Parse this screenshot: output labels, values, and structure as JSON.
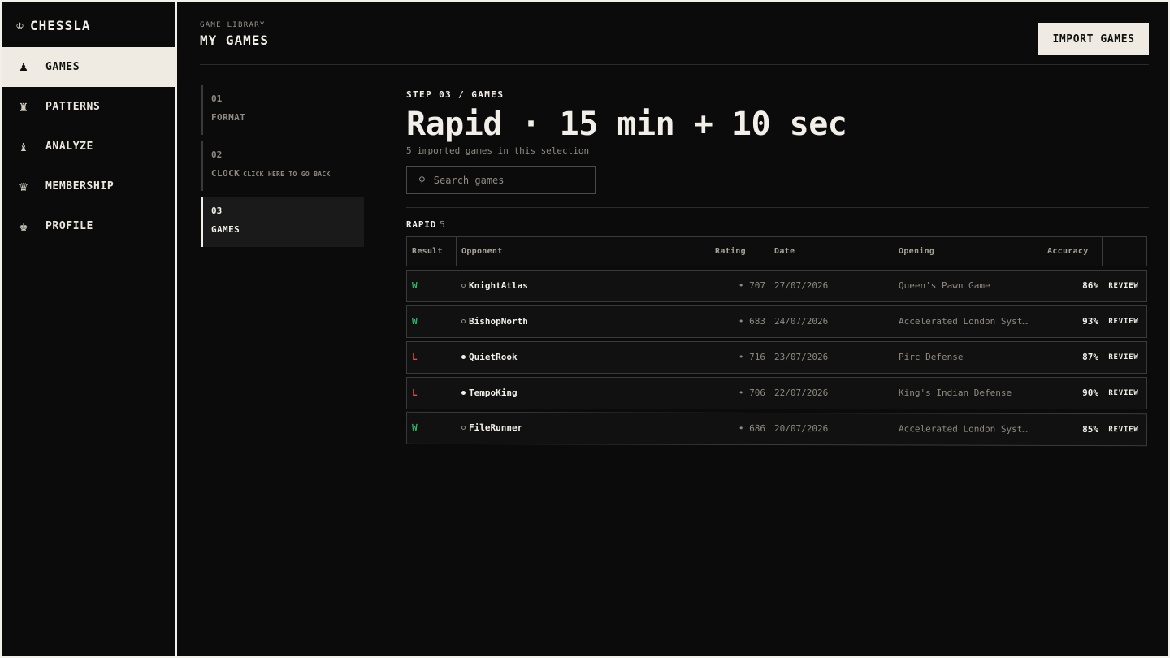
{
  "brand": {
    "icon": "king-icon",
    "name": "CHESSLA"
  },
  "sidebar": {
    "items": [
      {
        "label": "GAMES",
        "icon": "pawn-icon",
        "glyph": "♟",
        "active": true
      },
      {
        "label": "PATTERNS",
        "icon": "rook-icon",
        "glyph": "♜",
        "active": false
      },
      {
        "label": "ANALYZE",
        "icon": "bishop-icon",
        "glyph": "♝",
        "active": false
      },
      {
        "label": "MEMBERSHIP",
        "icon": "queen-icon",
        "glyph": "♛",
        "active": false
      },
      {
        "label": "PROFILE",
        "icon": "king-icon",
        "glyph": "♚",
        "active": false
      }
    ]
  },
  "header": {
    "eyebrow": "GAME LIBRARY",
    "title": "MY GAMES",
    "import_label": "IMPORT GAMES"
  },
  "steps": [
    {
      "num": "01",
      "title": "FORMAT",
      "hint": ""
    },
    {
      "num": "02",
      "title": "CLOCK",
      "hint": "CLICK HERE TO GO BACK"
    },
    {
      "num": "03",
      "title": "GAMES",
      "hint": ""
    }
  ],
  "main": {
    "step_label": "STEP 03 / GAMES",
    "title": "Rapid · 15 min + 10 sec",
    "subtitle": "5 imported games in this selection",
    "search_placeholder": "Search games",
    "group_label": "RAPID",
    "group_count": "5"
  },
  "table": {
    "headers": {
      "result": "Result",
      "opponent": "Opponent",
      "rating": "Rating",
      "date": "Date",
      "opening": "Opening",
      "accuracy": "Accuracy"
    },
    "rows": [
      {
        "result": "W",
        "opponent": "KnightAtlas",
        "rating": "• 707",
        "date": "27/07/2026",
        "opening": "Queen's Pawn Game",
        "accuracy": "86%",
        "action": "REVIEW",
        "dot": "hollow"
      },
      {
        "result": "W",
        "opponent": "BishopNorth",
        "rating": "• 683",
        "date": "24/07/2026",
        "opening": "Accelerated London Syst…",
        "accuracy": "93%",
        "action": "REVIEW",
        "dot": "hollow"
      },
      {
        "result": "L",
        "opponent": "QuietRook",
        "rating": "• 716",
        "date": "23/07/2026",
        "opening": "Pirc Defense",
        "accuracy": "87%",
        "action": "REVIEW",
        "dot": "filled"
      },
      {
        "result": "L",
        "opponent": "TempoKing",
        "rating": "• 706",
        "date": "22/07/2026",
        "opening": "King's Indian Defense",
        "accuracy": "90%",
        "action": "REVIEW",
        "dot": "filled"
      },
      {
        "result": "W",
        "opponent": "FileRunner",
        "rating": "• 686",
        "date": "20/07/2026",
        "opening": "Accelerated London Syst…",
        "accuracy": "85%",
        "action": "REVIEW",
        "dot": "hollow"
      }
    ]
  },
  "colors": {
    "win": "#2fb566",
    "loss": "#e34b3f",
    "accent": "#efebe2"
  }
}
